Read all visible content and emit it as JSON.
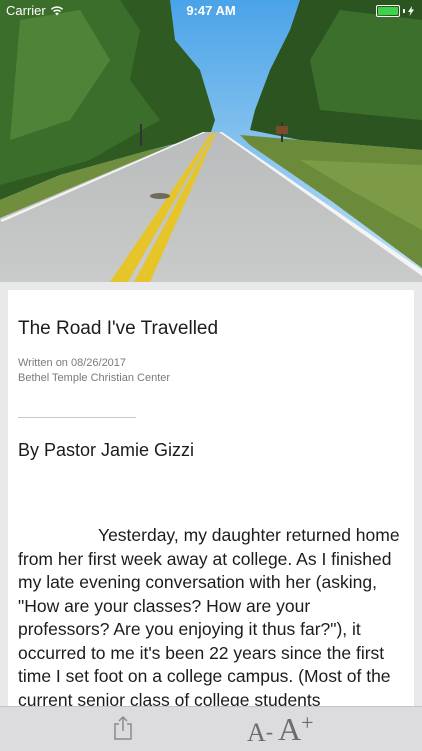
{
  "status_bar": {
    "carrier": "Carrier",
    "time": "9:47 AM",
    "wifi_icon": "wifi-icon",
    "battery_icon": "battery-icon",
    "battery_level": 1.0,
    "charging_icon": "bolt-icon"
  },
  "hero": {
    "description_icon": "road-photo"
  },
  "article": {
    "title": "The Road I've Travelled",
    "written_on": "Written on 08/26/2017",
    "organization": "Bethel Temple Christian Center",
    "byline": "By Pastor Jamie Gizzi",
    "body": "Yesterday, my daughter returned home from her first week away at college.  As I finished my late evening conversation with her (asking, \"How are your classes?  How are your professors?  Are you enjoying it thus far?\"), it occurred to me it's been 22 years since the first time I set foot on a college campus.  (Most of the current senior class of college students"
  },
  "toolbar": {
    "share_icon": "share-icon",
    "decrease_label_a": "A",
    "decrease_label_sign": "-",
    "increase_label_a": "A",
    "increase_label_sign": "+"
  },
  "colors": {
    "toolbar_bg": "#dcdcdf",
    "page_bg": "#e9e9ec",
    "battery_green": "#3fd14b"
  }
}
